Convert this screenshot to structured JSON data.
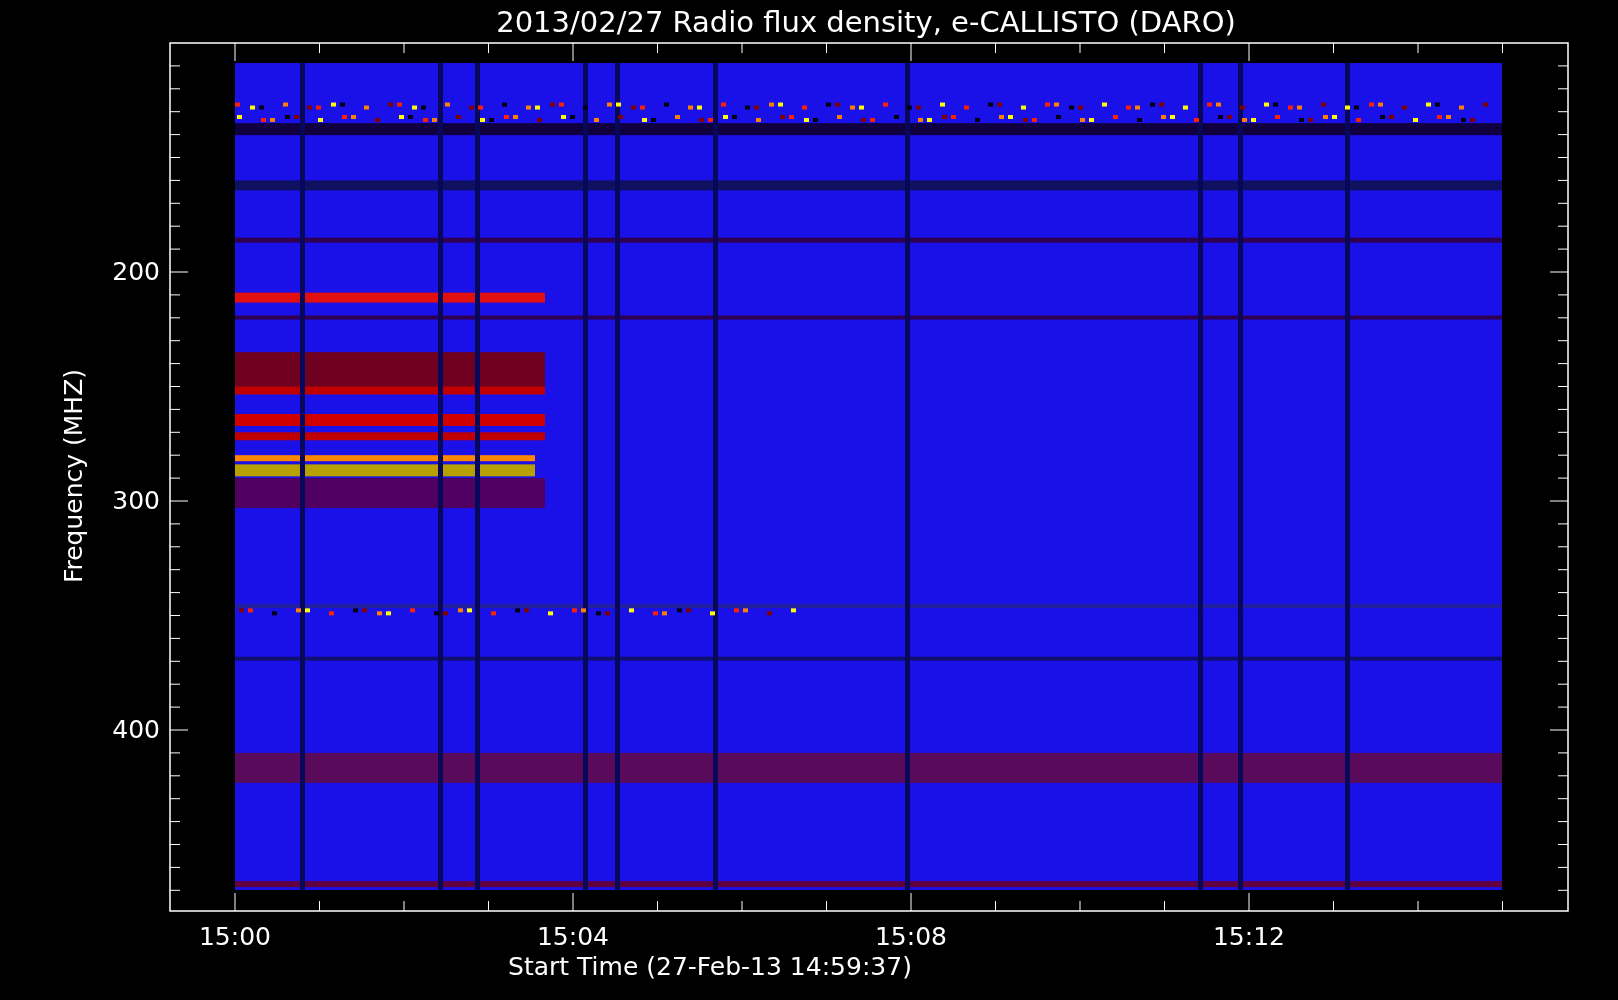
{
  "plot": {
    "title": "2013/02/27  Radio flux density, e-CALLISTO (DARO)",
    "ylabel": "Frequency (MHZ)",
    "xlabel": "Start Time (27-Feb-13 14:59:37)",
    "yticks": [
      "200",
      "300",
      "400"
    ],
    "xticks": [
      "15:00",
      "15:04",
      "15:08",
      "15:12"
    ]
  }
}
